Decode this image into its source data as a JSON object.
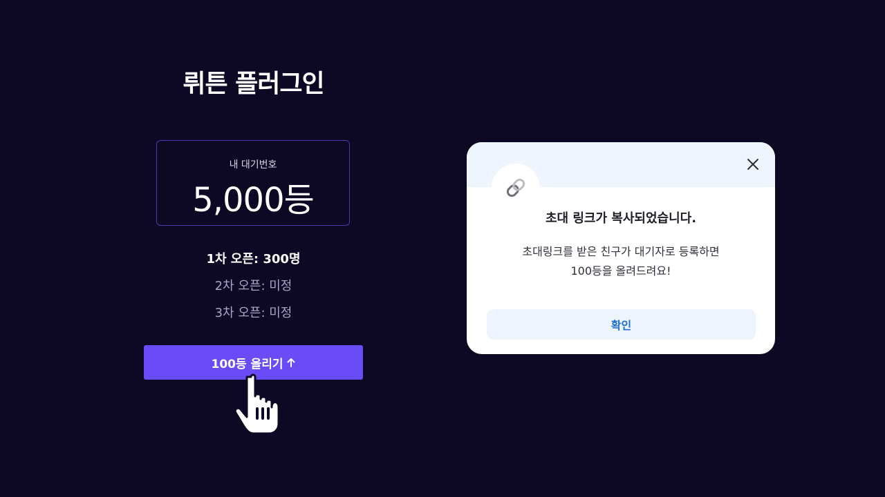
{
  "left_panel": {
    "title": "뤼튼 플러그인",
    "rank_label": "내 대기번호",
    "rank_value": "5,000등",
    "open_items": [
      "1차 오픈: 300명",
      "2차 오픈: 미정",
      "3차 오픈: 미정"
    ],
    "boost_button_label": "100등 올리기",
    "boost_button_icon": "arrow-up-icon"
  },
  "dialog": {
    "icon": "link-icon",
    "close_icon": "close-icon",
    "title": "초대 링크가 복사되었습니다.",
    "body_line1": "초대링크를 받은 친구가 대기자로 등록하면",
    "body_line2": "100등을 올려드려요!",
    "confirm_label": "확인"
  },
  "colors": {
    "background": "#0d0824",
    "accent": "#6a4cf6",
    "dialog_header": "#eef5fd",
    "confirm_text": "#1d6fcf"
  }
}
